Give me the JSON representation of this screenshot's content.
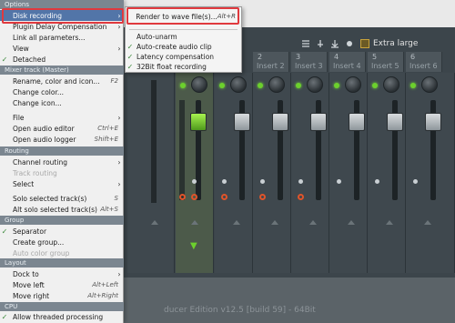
{
  "menu": {
    "sections": {
      "options": "Options",
      "mixer_track": "Mixer track (Master)",
      "routing": "Routing",
      "group": "Group",
      "layout": "Layout",
      "cpu": "CPU"
    },
    "items": {
      "disk_recording": "Disk recording",
      "plugin_delay": "Plugin Delay Compensation",
      "link_all": "Link all parameters...",
      "view": "View",
      "detached": "Detached",
      "rename": "Rename, color and icon...",
      "rename_sc": "F2",
      "change_color": "Change color...",
      "change_icon": "Change icon...",
      "file": "File",
      "open_audio_editor": "Open audio editor",
      "open_audio_editor_sc": "Ctrl+E",
      "open_audio_logger": "Open audio logger",
      "open_audio_logger_sc": "Shift+E",
      "channel_routing": "Channel routing",
      "track_routing": "Track routing",
      "select": "Select",
      "solo_selected": "Solo selected track(s)",
      "solo_selected_sc": "S",
      "alt_solo": "Alt solo selected track(s)",
      "alt_solo_sc": "Alt+S",
      "separator": "Separator",
      "create_group": "Create group...",
      "auto_color_group": "Auto color group",
      "dock_to": "Dock to",
      "move_left": "Move left",
      "move_left_sc": "Alt+Left",
      "move_right": "Move right",
      "move_right_sc": "Alt+Right",
      "threaded": "Allow threaded processing"
    }
  },
  "submenu": {
    "render": "Render to wave file(s)...",
    "render_sc": "Alt+R",
    "auto_unarm": "Auto-unarm",
    "auto_create": "Auto-create audio clip",
    "latency": "Latency compensation",
    "float32": "32Bit float recording"
  },
  "mixer": {
    "extra": "Extra large",
    "channels": [
      {
        "num": "2",
        "name": "Insert 2"
      },
      {
        "num": "3",
        "name": "Insert 3"
      },
      {
        "num": "4",
        "name": "Insert 4"
      },
      {
        "num": "5",
        "name": "Insert 5"
      },
      {
        "num": "6",
        "name": "Insert 6"
      }
    ],
    "footer": "ducer Edition v12.5 [build 59] - 64Bit"
  },
  "colors": {
    "menu_highlight": "#5275a8",
    "annotation_red": "#e0393e",
    "fader_green": "#6cd02d"
  }
}
